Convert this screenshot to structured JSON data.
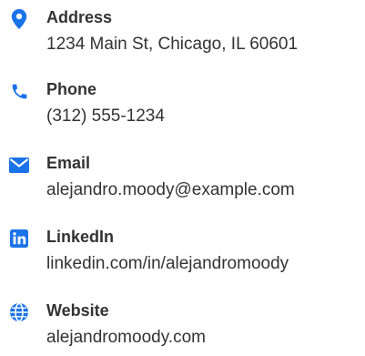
{
  "accent_color": "#1a73e8",
  "text_color": "#333333",
  "contacts": [
    {
      "icon": "map-pin-icon",
      "label": "Address",
      "value": "1234 Main St, Chicago, IL 60601"
    },
    {
      "icon": "phone-icon",
      "label": "Phone",
      "value": "(312) 555-1234"
    },
    {
      "icon": "envelope-icon",
      "label": "Email",
      "value": "alejandro.moody@example.com"
    },
    {
      "icon": "linkedin-icon",
      "label": "LinkedIn",
      "value": "linkedin.com/in/alejandromoody"
    },
    {
      "icon": "globe-icon",
      "label": "Website",
      "value": "alejandromoody.com"
    }
  ]
}
